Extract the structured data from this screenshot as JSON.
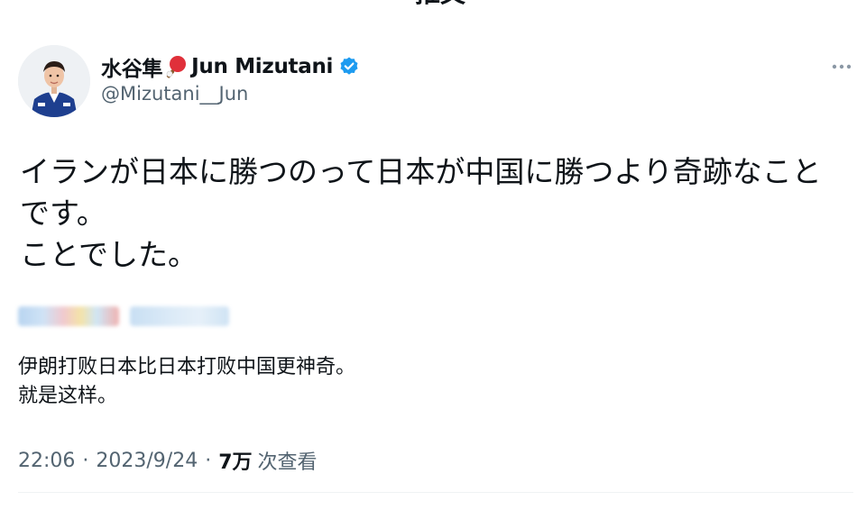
{
  "topbar": {
    "back_icon": "chevron-left-icon",
    "title": "推文"
  },
  "author": {
    "name_jp": "水谷隼",
    "name_en": "Jun Mizutani",
    "handle": "@Mizutani__Jun",
    "badge": "verified-icon",
    "emoji": "ping-pong-paddle-icon"
  },
  "more_icon": "more-horizontal-icon",
  "tweet": {
    "text": "イランが日本に勝つのって日本が中国に勝つより奇跡なこと\nです。\nことでした。"
  },
  "translation": {
    "text": "伊朗打败日本比日本打败中国更神奇。\n就是这样。"
  },
  "meta": {
    "time": "22:06",
    "sep1": "·",
    "date": "2023/9/24",
    "sep2": "·",
    "views": "7万",
    "views_label": "次查看"
  },
  "colors": {
    "text_primary": "#0f1419",
    "text_secondary": "#536471",
    "verified_blue": "#1d9bf0",
    "paddle_red": "#e0303a",
    "divider": "#eff3f4"
  }
}
